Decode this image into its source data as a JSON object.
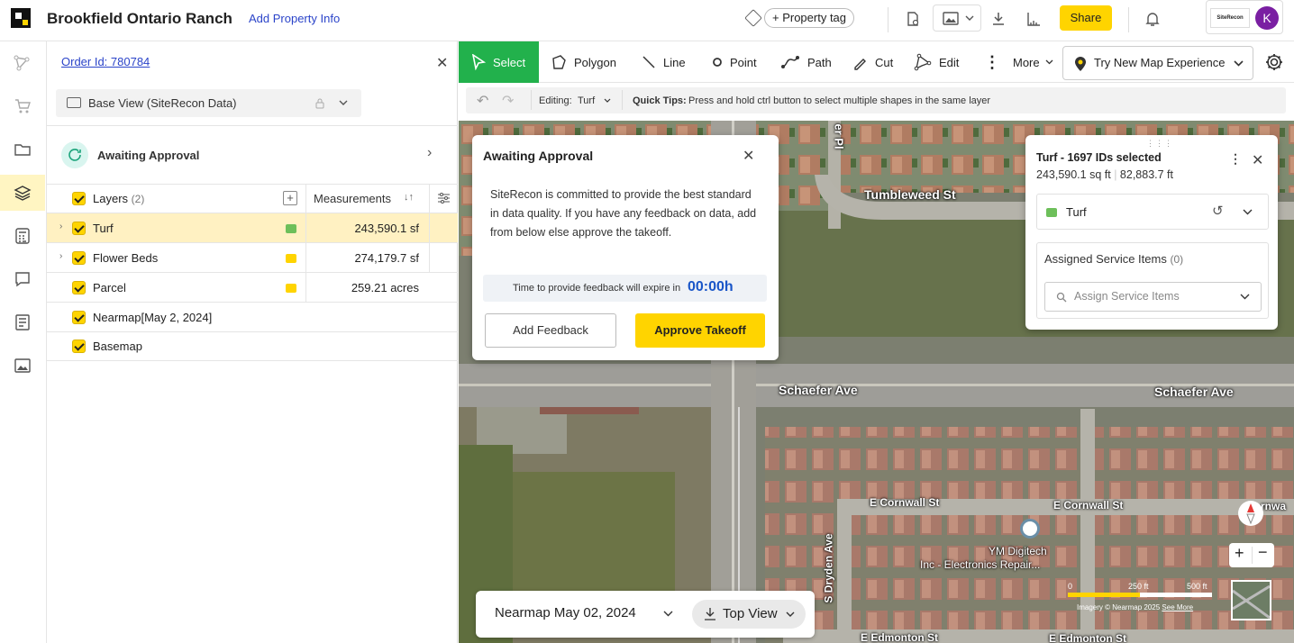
{
  "header": {
    "title": "Brookfield Ontario Ranch",
    "add_property_info": "Add Property Info",
    "property_tag": "+ Property tag",
    "share": "Share",
    "avatar_initial": "K",
    "logo_text": "SiteRecon"
  },
  "panel": {
    "order_id": "Order Id: 780784",
    "base_view": "Base View (SiteRecon Data)",
    "status": "Awaiting Approval",
    "layers_header": "Layers",
    "layers_count": "(2)",
    "measurements_header": "Measurements",
    "layers": [
      {
        "name": "Turf",
        "measurement": "243,590.1 sf",
        "color": "#4caf50"
      },
      {
        "name": "Flower Beds",
        "measurement": "274,179.7 sf",
        "color": "#ffd400"
      },
      {
        "name": "Parcel",
        "measurement": "259.21 acres",
        "color": "#ffd400"
      },
      {
        "name": "Nearmap",
        "date": "[May 2, 2024]"
      },
      {
        "name": "Basemap"
      }
    ]
  },
  "toolbar": {
    "select": "Select",
    "polygon": "Polygon",
    "line": "Line",
    "point": "Point",
    "path": "Path",
    "cut": "Cut",
    "edit": "Edit",
    "more": "More",
    "try_new": "Try New Map Experience"
  },
  "subbar": {
    "editing_label": "Editing:",
    "editing_value": "Turf",
    "tips_label": "Quick Tips:",
    "tips_text": "Press and hold ctrl button to select multiple shapes in the same layer"
  },
  "dialog": {
    "title": "Awaiting Approval",
    "body": "SiteRecon is committed to provide the best standard in data quality. If you have any feedback on data, add from below else approve the takeoff.",
    "timer_label": "Time to provide feedback will expire in",
    "timer_value": "00:00h",
    "feedback_btn": "Add Feedback",
    "approve_btn": "Approve Takeoff"
  },
  "selection": {
    "title": "Turf - 1697 IDs selected",
    "area": "243,590.1 sq ft",
    "perimeter": "82,883.7 ft",
    "layer": "Turf",
    "assigned_label": "Assigned Service Items",
    "assigned_count": "(0)",
    "assign_placeholder": "Assign Service Items"
  },
  "map": {
    "streets": [
      "Tumbleweed St",
      "Schaefer Ave",
      "Schaefer Ave",
      "E Cornwall St",
      "E Cornwall St",
      "S Dryden Ave",
      "E Edmonton St",
      "E Edmonton St",
      "er Pl",
      "rnwa"
    ],
    "poi": [
      "YM Digitech",
      "Inc - Electronics Repair..."
    ],
    "scale_labels": [
      "0",
      "250 ft",
      "500 ft"
    ],
    "attribution": "Imagery © Nearmap 2025",
    "attribution_link": "See More"
  },
  "bottom": {
    "imagery": "Nearmap May 02, 2024",
    "view": "Top View"
  }
}
